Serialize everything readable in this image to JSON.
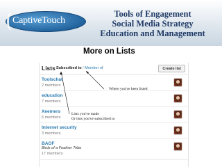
{
  "header": {
    "logo_text": "CaptiveTouch",
    "lines": [
      "Tools of Engagement",
      "Social Media Strategy",
      "Education and Management"
    ]
  },
  "section_title": "More on Lists",
  "panel": {
    "title": "Lists",
    "tab_active": "Subscribed to",
    "tab_sep": "/",
    "tab_link": "Member of",
    "create_button": "Create list",
    "rows": [
      {
        "name": "Toolschat",
        "subtitle": "",
        "count": "2 members"
      },
      {
        "name": "education",
        "subtitle": "",
        "count": "7 members"
      },
      {
        "name": "Xeemers",
        "subtitle": "",
        "count": "6 members"
      },
      {
        "name": "Internet security",
        "subtitle": "",
        "count": "3 members"
      },
      {
        "name": "BAOF",
        "subtitle": "Birds of a Feather Tribe",
        "count": "17 members"
      }
    ]
  },
  "annotations": {
    "been_listed": "Where you've been listed",
    "made_line1": "Lists you've made",
    "made_line2": "Or lists you've subscribed to"
  }
}
